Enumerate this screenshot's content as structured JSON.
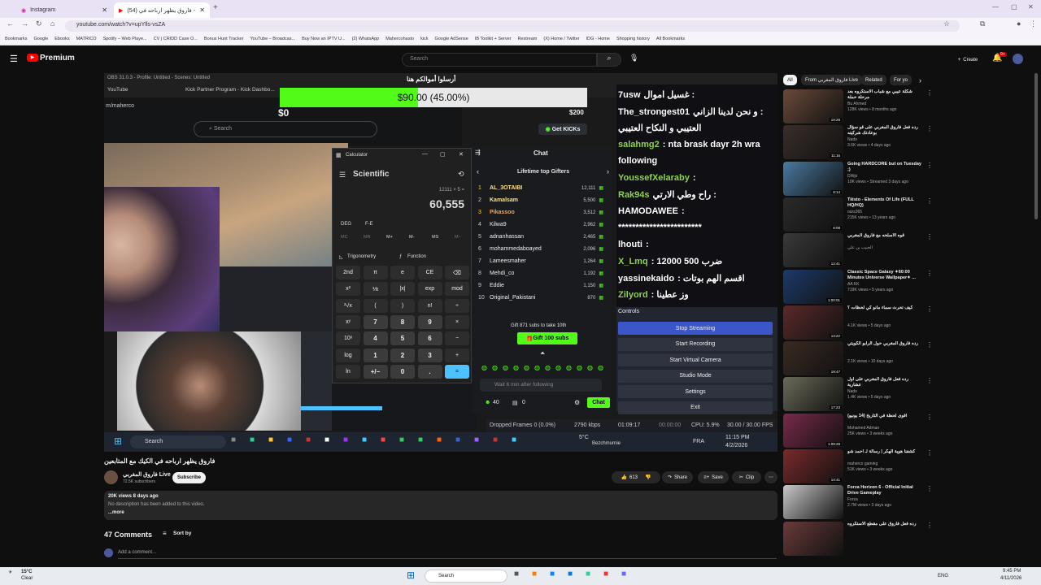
{
  "browser": {
    "tabs": [
      {
        "label": "Instagram",
        "active": false
      },
      {
        "label": "فاروق يظهر ارباحه في (54) - YouTube",
        "active": true
      }
    ],
    "url": "youtube.com/watch?v=upYlls-vsZA",
    "bookmarks": [
      "Bookmarks",
      "Google",
      "Ebooks",
      "MATRICO",
      "Spotify – Web Playe...",
      "CV | CRIDD Case O...",
      "Bonus Hunt Tracker",
      "YouTube – Broadcas...",
      "Buy Now an IPTV U...",
      "(2) WhatsApp",
      "Mahercohasto",
      "kick",
      "Google AdSense",
      "IB Toolkit + Server",
      "Restream",
      "(X) Home / Twitter",
      "IDG - Home",
      "Shopping history",
      "All Bookmarks"
    ]
  },
  "youtube": {
    "brand": "Premium",
    "search_placeholder": "Search",
    "create_label": "Create",
    "notif_count": "9+"
  },
  "stream": {
    "obs_title": "OBS 31.0.3 - Profile: Untitled - Scenes: Untitled",
    "kick_tab1": "YouTube",
    "kick_tab2": "Kick Partner Program - Kick Dashbo...",
    "goal_header": "أرسلوا أموالكم هنا",
    "goal_amount": "$90.00 (45.00%)",
    "goal_progress": 45,
    "goal_left": "$0",
    "goal_right": "$200",
    "channel_path": "m/maherco",
    "kick_search": "Search",
    "get_kicks": "Get KICKs",
    "calculator": {
      "app": "Calculator",
      "mode": "Scientific",
      "expression": "12111 × 5 =",
      "result": "60,555",
      "deg": "DEG",
      "fe": "F-E",
      "memory": [
        "MC",
        "MR",
        "M+",
        "M-",
        "MS",
        "M~"
      ],
      "trig": "Trigonometry",
      "func": "Function",
      "keys": [
        "2nd",
        "π",
        "e",
        "CE",
        "⌫",
        "x²",
        "⅟x",
        "|x|",
        "exp",
        "mod",
        "²√x",
        "(",
        ")",
        "n!",
        "÷",
        "xʸ",
        "7",
        "8",
        "9",
        "×",
        "10ˣ",
        "4",
        "5",
        "6",
        "−",
        "log",
        "1",
        "2",
        "3",
        "+",
        "ln",
        "+/−",
        "0",
        ".",
        "="
      ]
    },
    "chat_title": "Chat",
    "gifters_title": "Lifetime top Gifters",
    "gifters": [
      {
        "rank": "1",
        "name": "AL_3OTAIBI",
        "count": "12,111"
      },
      {
        "rank": "2",
        "name": "Kamalsam",
        "count": "5,500"
      },
      {
        "rank": "3",
        "name": "Pikassoo",
        "count": "3,512"
      },
      {
        "rank": "4",
        "name": "Kilwa9",
        "count": "2,962"
      },
      {
        "rank": "5",
        "name": "adnanhassan",
        "count": "2,465"
      },
      {
        "rank": "6",
        "name": "mohammedaboayed",
        "count": "2,096"
      },
      {
        "rank": "7",
        "name": "Lameesmaher",
        "count": "1,264"
      },
      {
        "rank": "8",
        "name": "Mehdi_co",
        "count": "1,192"
      },
      {
        "rank": "9",
        "name": "Eddie",
        "count": "1,150"
      },
      {
        "rank": "10",
        "name": "Original_Pakistani",
        "count": "870"
      }
    ],
    "gift_note": "Gift 871 subs to take 10th",
    "gift_button": "Gift 100 subs",
    "wait_text": "Wait 6 min after following",
    "viewers": "40",
    "other_count": "0",
    "chat_button": "Chat",
    "chat_messages": [
      {
        "user": "7usw",
        "text": "غسيل اموال :",
        "color": "#ffffff"
      },
      {
        "user": "The_strongest01",
        "text": "و نحن لدينا الزاني :",
        "color": "#ffffff"
      },
      {
        "user": "",
        "text": "العتيبي و النكاح العتيبي",
        "color": "#ffffff"
      },
      {
        "user": "salahmg2",
        "text": ": nta brask dayr 2h wra",
        "color": "#8fd14f"
      },
      {
        "user": "",
        "text": "following",
        "color": "#ffffff"
      },
      {
        "user": "YoussefXelaraby",
        "text": ":",
        "color": "#8fd14f"
      },
      {
        "user": "Rak94s",
        "text": "راح وطي الارتي :",
        "color": "#8fd14f"
      },
      {
        "user": "HAMODAWEE",
        "text": ":",
        "color": "#ffffff"
      },
      {
        "user": "",
        "text": "************************",
        "color": "#ffffff"
      },
      {
        "user": "lhouti",
        "text": ":",
        "color": "#ffffff"
      },
      {
        "user": "X_Lmq",
        "text": ": 12000 500 ضرب",
        "color": "#8fd14f"
      },
      {
        "user": "yassinekaido",
        "text": ": اقسم الهم بوتات",
        "color": "#ffffff"
      },
      {
        "user": "Zilyord",
        "text": ": وز عطينا",
        "color": "#8fd14f"
      }
    ],
    "controls_title": "Controls",
    "controls": [
      "Stop Streaming",
      "Start Recording",
      "Start Virtual Camera",
      "Studio Mode",
      "Settings",
      "Exit"
    ],
    "obs_status": {
      "dropped": "Dropped Frames 0 (0.0%)",
      "kbps": "2790 kbps",
      "live_time": "01:09:17",
      "rec_time": "00:00:00",
      "cpu": "CPU: 5.9%",
      "fps": "30.00 / 30.00 FPS"
    },
    "taskbar": {
      "search": "Search",
      "weather_temp": "5°C",
      "weather_loc": "Bezchmurnie",
      "lang": "FRA",
      "time": "11:15 PM",
      "date": "4/2/2026"
    }
  },
  "video": {
    "title": "فاروق يظهر ارباحه في الكيك مع المتابعين",
    "channel": "فاروق المغربي Live",
    "subscribers": "72.5K subscribers",
    "subscribe": "Subscribe",
    "likes": "613",
    "share": "Share",
    "save": "Save",
    "clip": "Clip",
    "views_date": "20K views 8 days ago",
    "description": "No description has been added to this video.",
    "more": "...more",
    "comments_count": "47 Comments",
    "sort_by": "Sort by",
    "add_comment": "Add a comment..."
  },
  "sidebar": {
    "chips": [
      "All",
      "From فاروق المغربي Live",
      "Related",
      "For yo"
    ],
    "videos": [
      {
        "title": "شكلة عيبي مع شباب الاستكروه بعد مرحلة حملة",
        "channel": "Bu Ahmed",
        "views": "128K views • 8 months ago",
        "duration": "19:28",
        "color": "#6a4a3a"
      },
      {
        "title": "رده فعل فاروق المغربي على قو سؤال بوعادتك شركيته",
        "channel": "Nado",
        "views": "3.6K views • 4 days ago",
        "duration": "11:16",
        "color": "#3a2e2a"
      },
      {
        "title": "Going HARDCORE but on Tuesday ;)",
        "channel": "DWpi",
        "views": "10K views • Streamed 3 days ago",
        "duration": "8:14",
        "color": "#4a7aa0"
      },
      {
        "title": "Tiësto - Elements Of Life (FULL HQ/HQ)",
        "channel": "ours365",
        "views": "215K views • 13 years ago",
        "duration": "8:08",
        "color": "#2a2a2a"
      },
      {
        "title": "قوه الاسلحه مع فاروق المغربي",
        "channel": "الحبيب بن علي",
        "views": "",
        "duration": "12:41",
        "color": "#3a3a3a"
      },
      {
        "title": "Classic Space Galaxy ✦60:00 Minutes Universe Wallpaper✦ ...",
        "channel": "AA KK",
        "views": "719K views • 5 years ago",
        "duration": "1:00:01",
        "color": "#1c3a6a"
      },
      {
        "title": "كيف تحرث سماء مانو كي لحظات ؟",
        "channel": "",
        "views": "4.1K views • 5 days ago",
        "duration": "13:22",
        "color": "#5a2a2a"
      },
      {
        "title": "رده فاروق المغربي حول الرابو الكويتي",
        "channel": "",
        "views": "2.1K views • 10 days ago",
        "duration": "19:47",
        "color": "#3a2a22"
      },
      {
        "title": "رده فعل فاروق المغربي على أول عشارية",
        "channel": "Nado",
        "views": "1.4K views • 5 days ago",
        "duration": "17:23",
        "color": "#6a6a5a"
      },
      {
        "title": "اقوى لحظة في التاريخ (14 يونيو)",
        "channel": "Mohamed Adman",
        "views": "25K views • 3 weeks ago",
        "duration": "1:09:28",
        "color": "#7a2a4a"
      },
      {
        "title": "كشفنا هوية الهكر | رسالة لـ احمد شو",
        "channel": "maherco gaming",
        "views": "51K views • 3 weeks ago",
        "duration": "14:41",
        "color": "#7a2a2a"
      },
      {
        "title": "Forza Horizon 6 - Official Initial Drive Gameplay",
        "channel": "Forza",
        "views": "2.7M views • 3 days ago",
        "duration": "",
        "color": "#c8c8c8"
      },
      {
        "title": "رده فعل فاروق على مقطع الاستكروه",
        "channel": "",
        "views": "",
        "duration": "",
        "color": "#6a3a3a"
      }
    ]
  },
  "wintask": {
    "temp": "15°C",
    "weather": "Clear",
    "search": "Search",
    "lang": "ENG",
    "time": "9:45 PM",
    "date": "4/11/2026"
  },
  "colors": {
    "goal_green": "#53fc18",
    "kick_green": "#53fc18",
    "obs_blue": "#3b56c9",
    "calc_accent": "#4cc2ff"
  }
}
